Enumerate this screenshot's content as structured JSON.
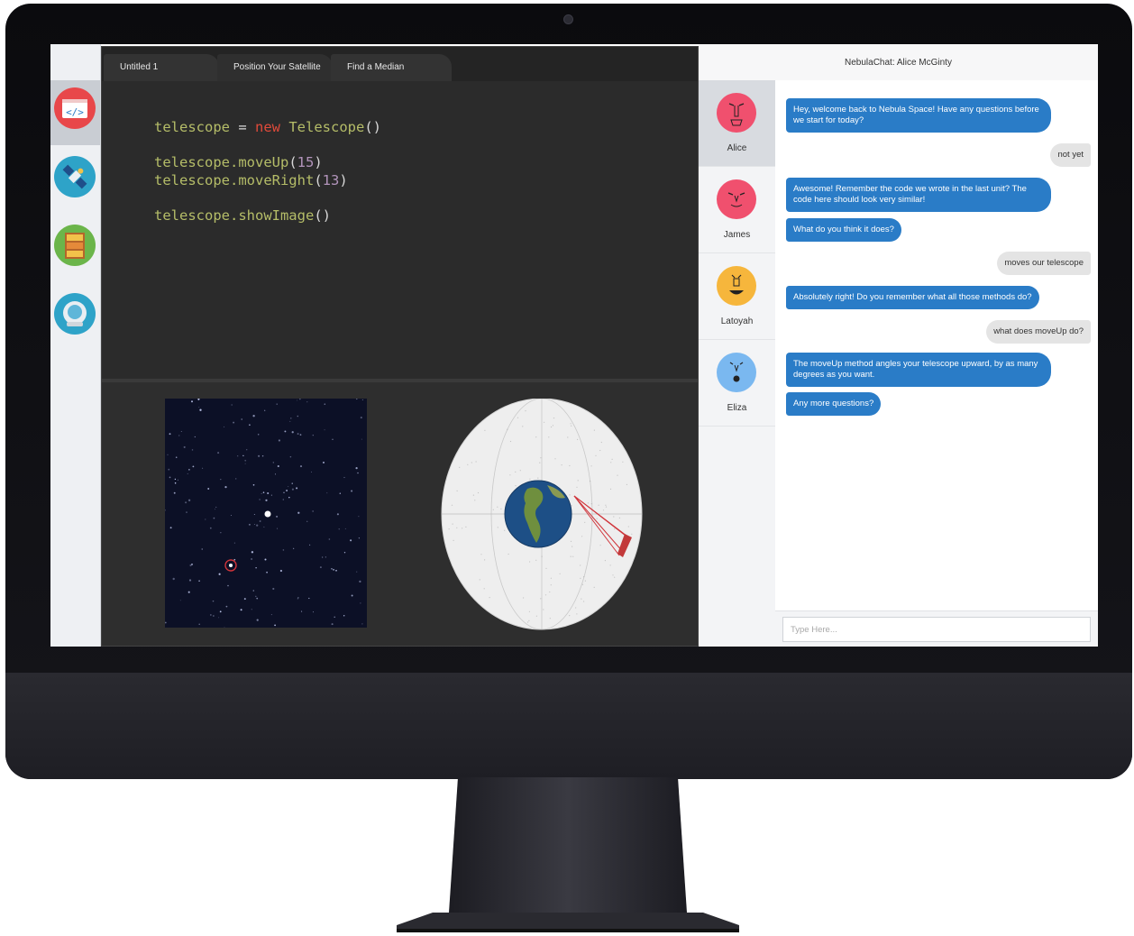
{
  "editor": {
    "tabs": [
      {
        "label": "Untitled 1"
      },
      {
        "label": "Position Your Satellite"
      },
      {
        "label": "Find a Median"
      }
    ],
    "active_tab": "Position Your Satellite",
    "code": {
      "line1": {
        "var": "telescope",
        "eq": " = ",
        "kw": "new",
        "cls": " Telescope",
        "tail": "()"
      },
      "line2": {
        "call": "telescope.moveUp",
        "open": "(",
        "arg": "15",
        "close": ")"
      },
      "line3": {
        "call": "telescope.moveRight",
        "open": "(",
        "arg": "13",
        "close": ")"
      },
      "line4": {
        "call": "telescope.showImage",
        "tail": "()"
      }
    }
  },
  "rail": {
    "items": [
      {
        "icon": "code-editor-icon",
        "color": "#e8474a",
        "active": true
      },
      {
        "icon": "satellite-icon",
        "color": "#2ea3c8"
      },
      {
        "icon": "bookshelf-icon",
        "color": "#6bb54a"
      },
      {
        "icon": "astronaut-helmet-icon",
        "color": "#2ea3c8"
      }
    ]
  },
  "chat": {
    "title": "NebulaChat: Alice McGinty",
    "contacts": [
      {
        "name": "Alice",
        "color": "#f0506e",
        "active": true
      },
      {
        "name": "James",
        "color": "#f0506e"
      },
      {
        "name": "Latoyah",
        "color": "#f6b63c"
      },
      {
        "name": "Eliza",
        "color": "#7ab8f0"
      }
    ],
    "messages": [
      {
        "from": "bot",
        "text": "Hey, welcome back to Nebula Space! Have any questions before we start for today?"
      },
      {
        "from": "me",
        "text": "not yet"
      },
      {
        "from": "bot",
        "text": "Awesome! Remember the code we wrote in the last unit? The code here should look very similar!"
      },
      {
        "from": "bot",
        "text": "What do you think it does?"
      },
      {
        "from": "me",
        "text": "moves our telescope"
      },
      {
        "from": "bot",
        "text": "Absolutely right! Do you remember what all those methods do?"
      },
      {
        "from": "me",
        "text": "what does moveUp do?"
      },
      {
        "from": "bot",
        "text": "The moveUp method angles your telescope upward, by as many degrees as you want."
      },
      {
        "from": "bot",
        "text": "Any more questions?"
      }
    ],
    "input_placeholder": "Type Here..."
  },
  "colors": {
    "chat_bubble_bot": "#2a7cc7",
    "chat_bubble_me": "#e4e4e4",
    "editor_bg": "#2b2b2b",
    "code_text": "#b5bd68",
    "code_keyword": "#e04a3a",
    "code_number": "#b294bb"
  }
}
